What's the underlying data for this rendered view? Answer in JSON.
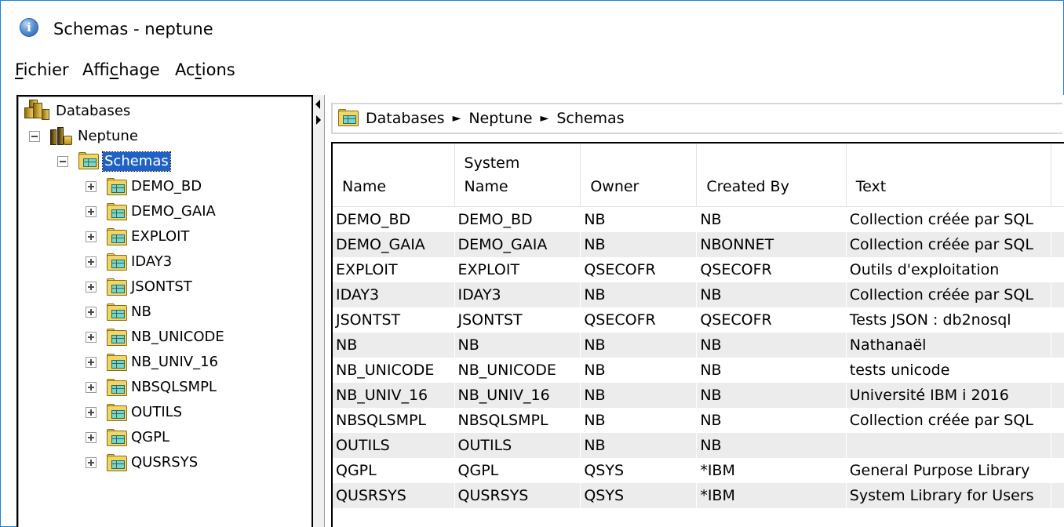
{
  "window": {
    "title": "Schemas - neptune"
  },
  "menu": {
    "items": [
      {
        "label": "Fichier",
        "underline": "F",
        "rest": "ichier"
      },
      {
        "label": "Affichage",
        "pre": "Affi",
        "underline": "c",
        "rest": "hage"
      },
      {
        "label": "Actions",
        "pre": "Ac",
        "underline": "t",
        "rest": "ions"
      }
    ]
  },
  "tree": {
    "root": "Databases",
    "system": "Neptune",
    "folder": "Schemas",
    "schemas": [
      "DEMO_BD",
      "DEMO_GAIA",
      "EXPLOIT",
      "IDAY3",
      "JSONTST",
      "NB",
      "NB_UNICODE",
      "NB_UNIV_16",
      "NBSQLSMPL",
      "OUTILS",
      "QGPL",
      "QUSRSYS"
    ]
  },
  "breadcrumb": {
    "parts": [
      "Databases",
      "Neptune",
      "Schemas"
    ],
    "separator": "►"
  },
  "table": {
    "columns": [
      {
        "line1": "",
        "line2": "Name"
      },
      {
        "line1": "System",
        "line2": "Name"
      },
      {
        "line1": "",
        "line2": "Owner"
      },
      {
        "line1": "",
        "line2": "Created By"
      },
      {
        "line1": "",
        "line2": "Text"
      }
    ],
    "rows": [
      [
        "DEMO_BD",
        "DEMO_BD",
        "NB",
        "NB",
        "Collection créée par SQL"
      ],
      [
        "DEMO_GAIA",
        "DEMO_GAIA",
        "NB",
        "NBONNET",
        "Collection créée par SQL"
      ],
      [
        "EXPLOIT",
        "EXPLOIT",
        "QSECOFR",
        "QSECOFR",
        "Outils d'exploitation"
      ],
      [
        "IDAY3",
        "IDAY3",
        "NB",
        "NB",
        "Collection créée par SQL"
      ],
      [
        "JSONTST",
        "JSONTST",
        "QSECOFR",
        "QSECOFR",
        "Tests JSON : db2nosql"
      ],
      [
        "NB",
        "NB",
        "NB",
        "NB",
        "Nathanaël"
      ],
      [
        "NB_UNICODE",
        "NB_UNICODE",
        "NB",
        "NB",
        "tests unicode"
      ],
      [
        "NB_UNIV_16",
        "NB_UNIV_16",
        "NB",
        "NB",
        "Université IBM i 2016"
      ],
      [
        "NBSQLSMPL",
        "NBSQLSMPL",
        "NB",
        "NB",
        "Collection créée par SQL"
      ],
      [
        "OUTILS",
        "OUTILS",
        "NB",
        "NB",
        ""
      ],
      [
        "QGPL",
        "QGPL",
        "QSYS",
        "*IBM",
        "General Purpose Library"
      ],
      [
        "QUSRSYS",
        "QUSRSYS",
        "QSYS",
        "*IBM",
        "System Library for Users"
      ]
    ]
  },
  "colors": {
    "window_border": "#1883d7",
    "selection": "#1f62c6",
    "row_alt": "#ececec"
  }
}
